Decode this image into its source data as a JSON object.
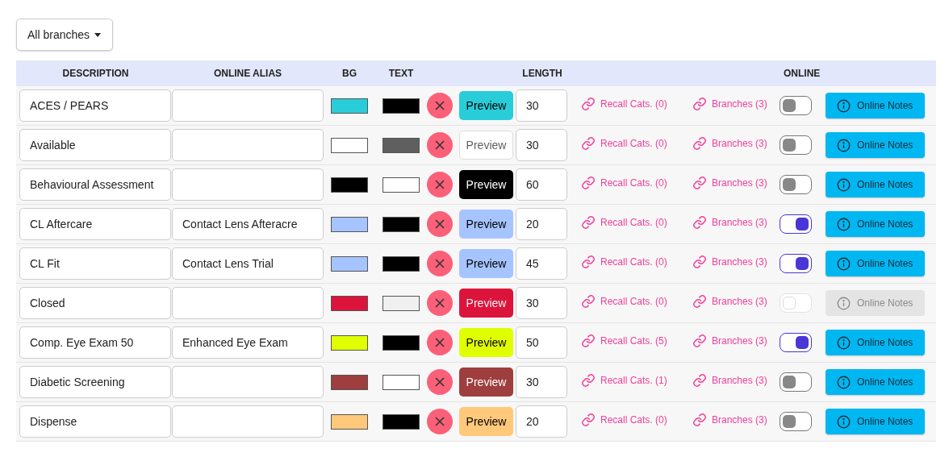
{
  "filter": {
    "label": "All branches"
  },
  "columns": {
    "description": "DESCRIPTION",
    "alias": "ONLINE ALIAS",
    "bg": "BG",
    "text": "TEXT",
    "length": "LENGTH",
    "online": "ONLINE"
  },
  "rows": [
    {
      "description": "ACES / PEARS",
      "bg": {
        "color": "#29cdd9"
      },
      "text": {
        "color": "#000000"
      },
      "preview": "Preview",
      "length": "30",
      "recall": "Recall Cats. (0)",
      "branches": "Branches (3)",
      "online": false,
      "disabled": false,
      "notes": "Online Notes"
    },
    {
      "description": "Available",
      "bg": {
        "color": "#ffffff"
      },
      "text": {
        "color": "#5f5f5f"
      },
      "preview": "Preview",
      "length": "30",
      "recall": "Recall Cats. (0)",
      "branches": "Branches (3)",
      "online": false,
      "disabled": false,
      "notes": "Online Notes"
    },
    {
      "description": "Behavioural Assessment",
      "bg": {
        "color": "#000000"
      },
      "text": {
        "color": "#ffffff"
      },
      "preview": "Preview",
      "length": "60",
      "recall": "Recall Cats. (0)",
      "branches": "Branches (3)",
      "online": false,
      "disabled": false,
      "notes": "Online Notes"
    },
    {
      "description": "CL Aftercare",
      "alias": "Contact Lens Afteracre",
      "bg": {
        "color": "#a6c4ff"
      },
      "text": {
        "color": "#000000"
      },
      "preview": "Preview",
      "length": "20",
      "recall": "Recall Cats. (0)",
      "branches": "Branches (3)",
      "online": true,
      "disabled": false,
      "notes": "Online Notes"
    },
    {
      "description": "CL Fit",
      "alias": "Contact Lens Trial",
      "bg": {
        "color": "#a6c4ff"
      },
      "text": {
        "color": "#000000"
      },
      "preview": "Preview",
      "length": "45",
      "recall": "Recall Cats. (0)",
      "branches": "Branches (3)",
      "online": true,
      "disabled": false,
      "notes": "Online Notes"
    },
    {
      "description": "Closed",
      "bg": {
        "color": "#dc143c"
      },
      "text": {
        "color": "#f0f0f0"
      },
      "preview": "Preview",
      "length": "30",
      "recall": "Recall Cats. (0)",
      "branches": "Branches (3)",
      "online": false,
      "disabled": true,
      "notes": "Online Notes"
    },
    {
      "description": "Comp. Eye Exam 50",
      "alias": "Enhanced Eye Exam",
      "bg": {
        "color": "#e0ff00"
      },
      "text": {
        "color": "#000000"
      },
      "preview": "Preview",
      "length": "50",
      "recall": "Recall Cats. (5)",
      "branches": "Branches (3)",
      "online": true,
      "disabled": false,
      "notes": "Online Notes"
    },
    {
      "description": "Diabetic Screening",
      "bg": {
        "color": "#9e3e3e"
      },
      "text": {
        "color": "#ffffff"
      },
      "preview": "Preview",
      "length": "30",
      "recall": "Recall Cats. (1)",
      "branches": "Branches (3)",
      "online": false,
      "disabled": false,
      "notes": "Online Notes"
    },
    {
      "description": "Dispense",
      "bg": {
        "color": "#ffc87a"
      },
      "text": {
        "color": "#000000"
      },
      "preview": "Preview",
      "length": "20",
      "recall": "Recall Cats. (0)",
      "branches": "Branches (3)",
      "online": false,
      "disabled": false,
      "notes": "Online Notes"
    }
  ]
}
